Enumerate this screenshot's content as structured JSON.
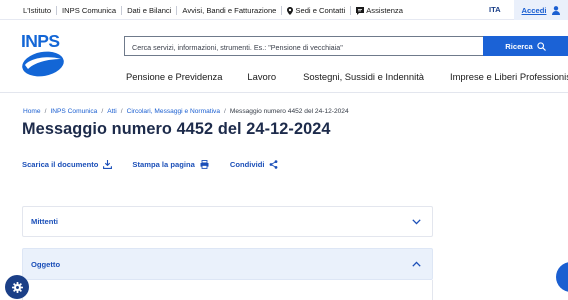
{
  "topbar": {
    "links": [
      "L'Istituto",
      "INPS Comunica",
      "Dati e Bilanci",
      "Avvisi, Bandi e Fatturazione",
      "Sedi e Contatti",
      "Assistenza"
    ],
    "lang": "ITA",
    "login": "Accedi"
  },
  "logo": {
    "text": "INPS"
  },
  "search": {
    "placeholder": "Cerca servizi, informazioni, strumenti. Es.: \"Pensione di vecchiaia\"",
    "button": "Ricerca"
  },
  "mainnav": [
    "Pensione e Previdenza",
    "Lavoro",
    "Sostegni, Sussidi e Indennità",
    "Imprese e Liberi Professionisti"
  ],
  "breadcrumb": [
    "Home",
    "INPS Comunica",
    "Atti",
    "Circolari, Messaggi e Normativa",
    "Messaggio numero 4452 del 24-12-2024"
  ],
  "page": {
    "title": "Messaggio numero 4452 del 24-12-2024"
  },
  "actions": [
    "Scarica il documento",
    "Stampa la pagina",
    "Condividi"
  ],
  "accordions": [
    {
      "label": "Mittenti",
      "state": "collapsed"
    },
    {
      "label": "Oggetto",
      "state": "expanded"
    }
  ],
  "colors": {
    "brand": "#1b62d6",
    "link": "#1b4fb8",
    "title": "#1d2b4b",
    "dark": "#1b3f87"
  },
  "icons": [
    "pin-icon",
    "chat-icon",
    "user-icon",
    "search-icon",
    "download-icon",
    "print-icon",
    "share-icon",
    "chevron-down-icon",
    "chevron-up-icon",
    "settings-icon"
  ]
}
